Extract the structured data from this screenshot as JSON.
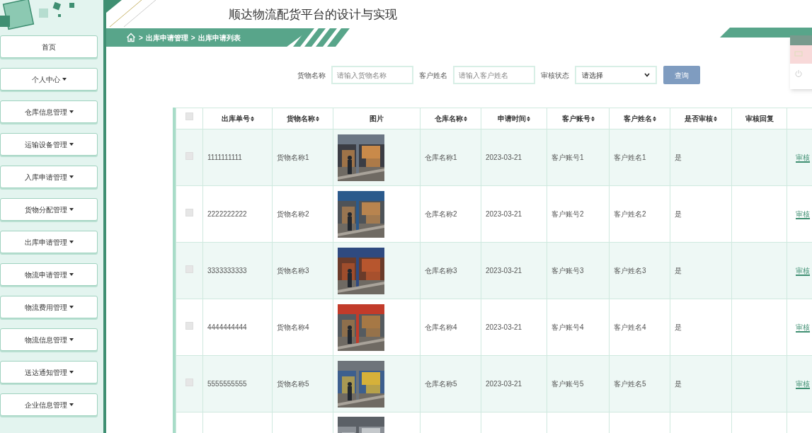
{
  "header": {
    "title": "顺达物流配货平台的设计与实现"
  },
  "breadcrumb": {
    "items": [
      ">",
      "出库申请管理",
      ">",
      "出库申请列表"
    ]
  },
  "sidebar": {
    "items": [
      {
        "label": "首页",
        "has_menu": false
      },
      {
        "label": "个人中心",
        "has_menu": true
      },
      {
        "label": "仓库信息管理",
        "has_menu": true
      },
      {
        "label": "运输设备管理",
        "has_menu": true
      },
      {
        "label": "入库申请管理",
        "has_menu": true
      },
      {
        "label": "货物分配管理",
        "has_menu": true
      },
      {
        "label": "出库申请管理",
        "has_menu": true
      },
      {
        "label": "物流申请管理",
        "has_menu": true
      },
      {
        "label": "物流费用管理",
        "has_menu": true
      },
      {
        "label": "物流信息管理",
        "has_menu": true
      },
      {
        "label": "送达通知管理",
        "has_menu": true
      },
      {
        "label": "企业信息管理",
        "has_menu": true
      }
    ]
  },
  "search": {
    "fields": [
      {
        "kind": "input",
        "label": "货物名称",
        "placeholder": "请输入货物名称"
      },
      {
        "kind": "input",
        "label": "客户姓名",
        "placeholder": "请输入客户姓名"
      },
      {
        "kind": "select",
        "label": "审核状态",
        "value": "请选择"
      }
    ],
    "button": "查询"
  },
  "table": {
    "select_all_checked": false,
    "columns": [
      {
        "label": "出库单号",
        "sortable": true
      },
      {
        "label": "货物名称",
        "sortable": true
      },
      {
        "label": "图片",
        "sortable": false
      },
      {
        "label": "仓库名称",
        "sortable": true
      },
      {
        "label": "申请时间",
        "sortable": true
      },
      {
        "label": "客户账号",
        "sortable": true
      },
      {
        "label": "客户姓名",
        "sortable": true
      },
      {
        "label": "是否审核",
        "sortable": true
      },
      {
        "label": "审核回复",
        "sortable": false
      }
    ],
    "rows": [
      {
        "checked": false,
        "cells": [
          "1111111111",
          "货物名称1",
          null,
          "仓库名称1",
          "2023-03-21",
          "客户账号1",
          "客户姓名1",
          "是",
          ""
        ],
        "action": "审核"
      },
      {
        "checked": false,
        "cells": [
          "2222222222",
          "货物名称2",
          null,
          "仓库名称2",
          "2023-03-21",
          "客户账号2",
          "客户姓名2",
          "是",
          ""
        ],
        "action": "审核"
      },
      {
        "checked": false,
        "cells": [
          "3333333333",
          "货物名称3",
          null,
          "仓库名称3",
          "2023-03-21",
          "客户账号3",
          "客户姓名3",
          "是",
          ""
        ],
        "action": "审核"
      },
      {
        "checked": false,
        "cells": [
          "4444444444",
          "货物名称4",
          null,
          "仓库名称4",
          "2023-03-21",
          "客户账号4",
          "客户姓名4",
          "是",
          ""
        ],
        "action": "审核"
      },
      {
        "checked": false,
        "cells": [
          "5555555555",
          "货物名称5",
          null,
          "仓库名称5",
          "2023-03-21",
          "客户账号5",
          "客户姓名5",
          "是",
          ""
        ],
        "action": "审核"
      },
      {
        "partial": true,
        "cells": [
          "",
          "",
          null,
          "",
          "",
          "",
          "",
          "",
          ""
        ]
      }
    ]
  }
}
